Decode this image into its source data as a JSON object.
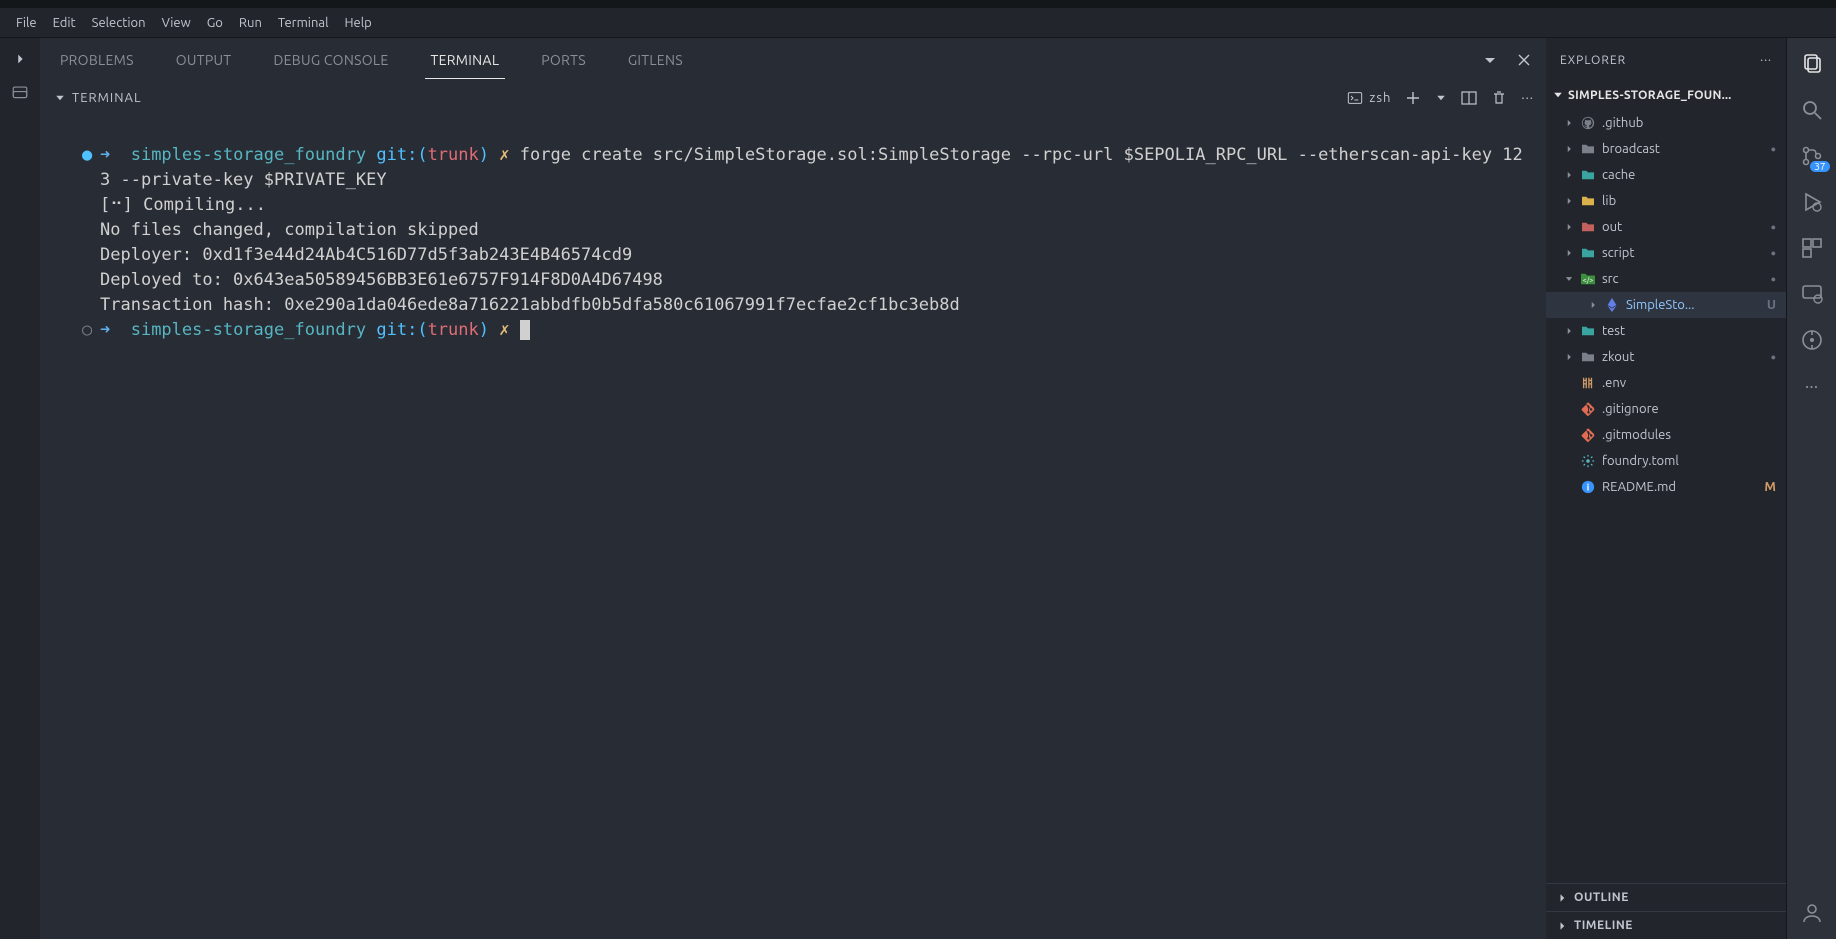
{
  "menubar": [
    "File",
    "Edit",
    "Selection",
    "View",
    "Go",
    "Run",
    "Terminal",
    "Help"
  ],
  "panel_tabs": {
    "problems": "PROBLEMS",
    "output": "OUTPUT",
    "debug": "DEBUG CONSOLE",
    "terminal": "TERMINAL",
    "ports": "PORTS",
    "gitlens": "GITLENS"
  },
  "terminal_section_label": "TERMINAL",
  "terminal_shell": "zsh",
  "prompt": {
    "dir": "simples-storage_foundry",
    "git_prefix": "git:(",
    "git_branch": "trunk",
    "git_suffix": ")",
    "dirty_mark": "✗"
  },
  "command": "forge create src/SimpleStorage.sol:SimpleStorage --rpc-url $SEPOLIA_RPC_URL --etherscan-api-key 123 --private-key $PRIVATE_KEY",
  "output_lines": [
    "[⠒] Compiling...",
    "No files changed, compilation skipped",
    "Deployer: 0xd1f3e44d24Ab4C516D77d5f3ab243E4B46574cd9",
    "Deployed to: 0x643ea50589456BB3E61e6757F914F8D0A4D67498",
    "Transaction hash: 0xe290a1da046ede8a716221abbdfb0b5dfa580c61067991f7ecfae2cf1bc3eb8d"
  ],
  "explorer": {
    "title": "EXPLORER",
    "project": "SIMPLES-STORAGE_FOUN...",
    "items": [
      {
        "name": ".github",
        "icon": "github",
        "dot": false
      },
      {
        "name": "broadcast",
        "icon": "folder-grey",
        "dot": true
      },
      {
        "name": "cache",
        "icon": "folder-teal",
        "dot": false
      },
      {
        "name": "lib",
        "icon": "folder-orange",
        "dot": false
      },
      {
        "name": "out",
        "icon": "folder-red",
        "dot": true
      },
      {
        "name": "script",
        "icon": "folder-teal",
        "dot": true
      },
      {
        "name": "src",
        "icon": "folder-code",
        "dot": true,
        "expanded": true,
        "children": [
          {
            "name": "SimpleSto...",
            "icon": "ethereum",
            "status": "U",
            "active": true
          }
        ]
      },
      {
        "name": "test",
        "icon": "folder-teal",
        "dot": false
      },
      {
        "name": "zkout",
        "icon": "folder-grey",
        "dot": true
      },
      {
        "name": ".env",
        "icon": "env",
        "file": true
      },
      {
        "name": ".gitignore",
        "icon": "git",
        "file": true
      },
      {
        "name": ".gitmodules",
        "icon": "git",
        "file": true
      },
      {
        "name": "foundry.toml",
        "icon": "gear",
        "file": true
      },
      {
        "name": "README.md",
        "icon": "info",
        "file": true,
        "status": "M"
      }
    ],
    "outline": "OUTLINE",
    "timeline": "TIMELINE"
  },
  "scm_badge": "37"
}
